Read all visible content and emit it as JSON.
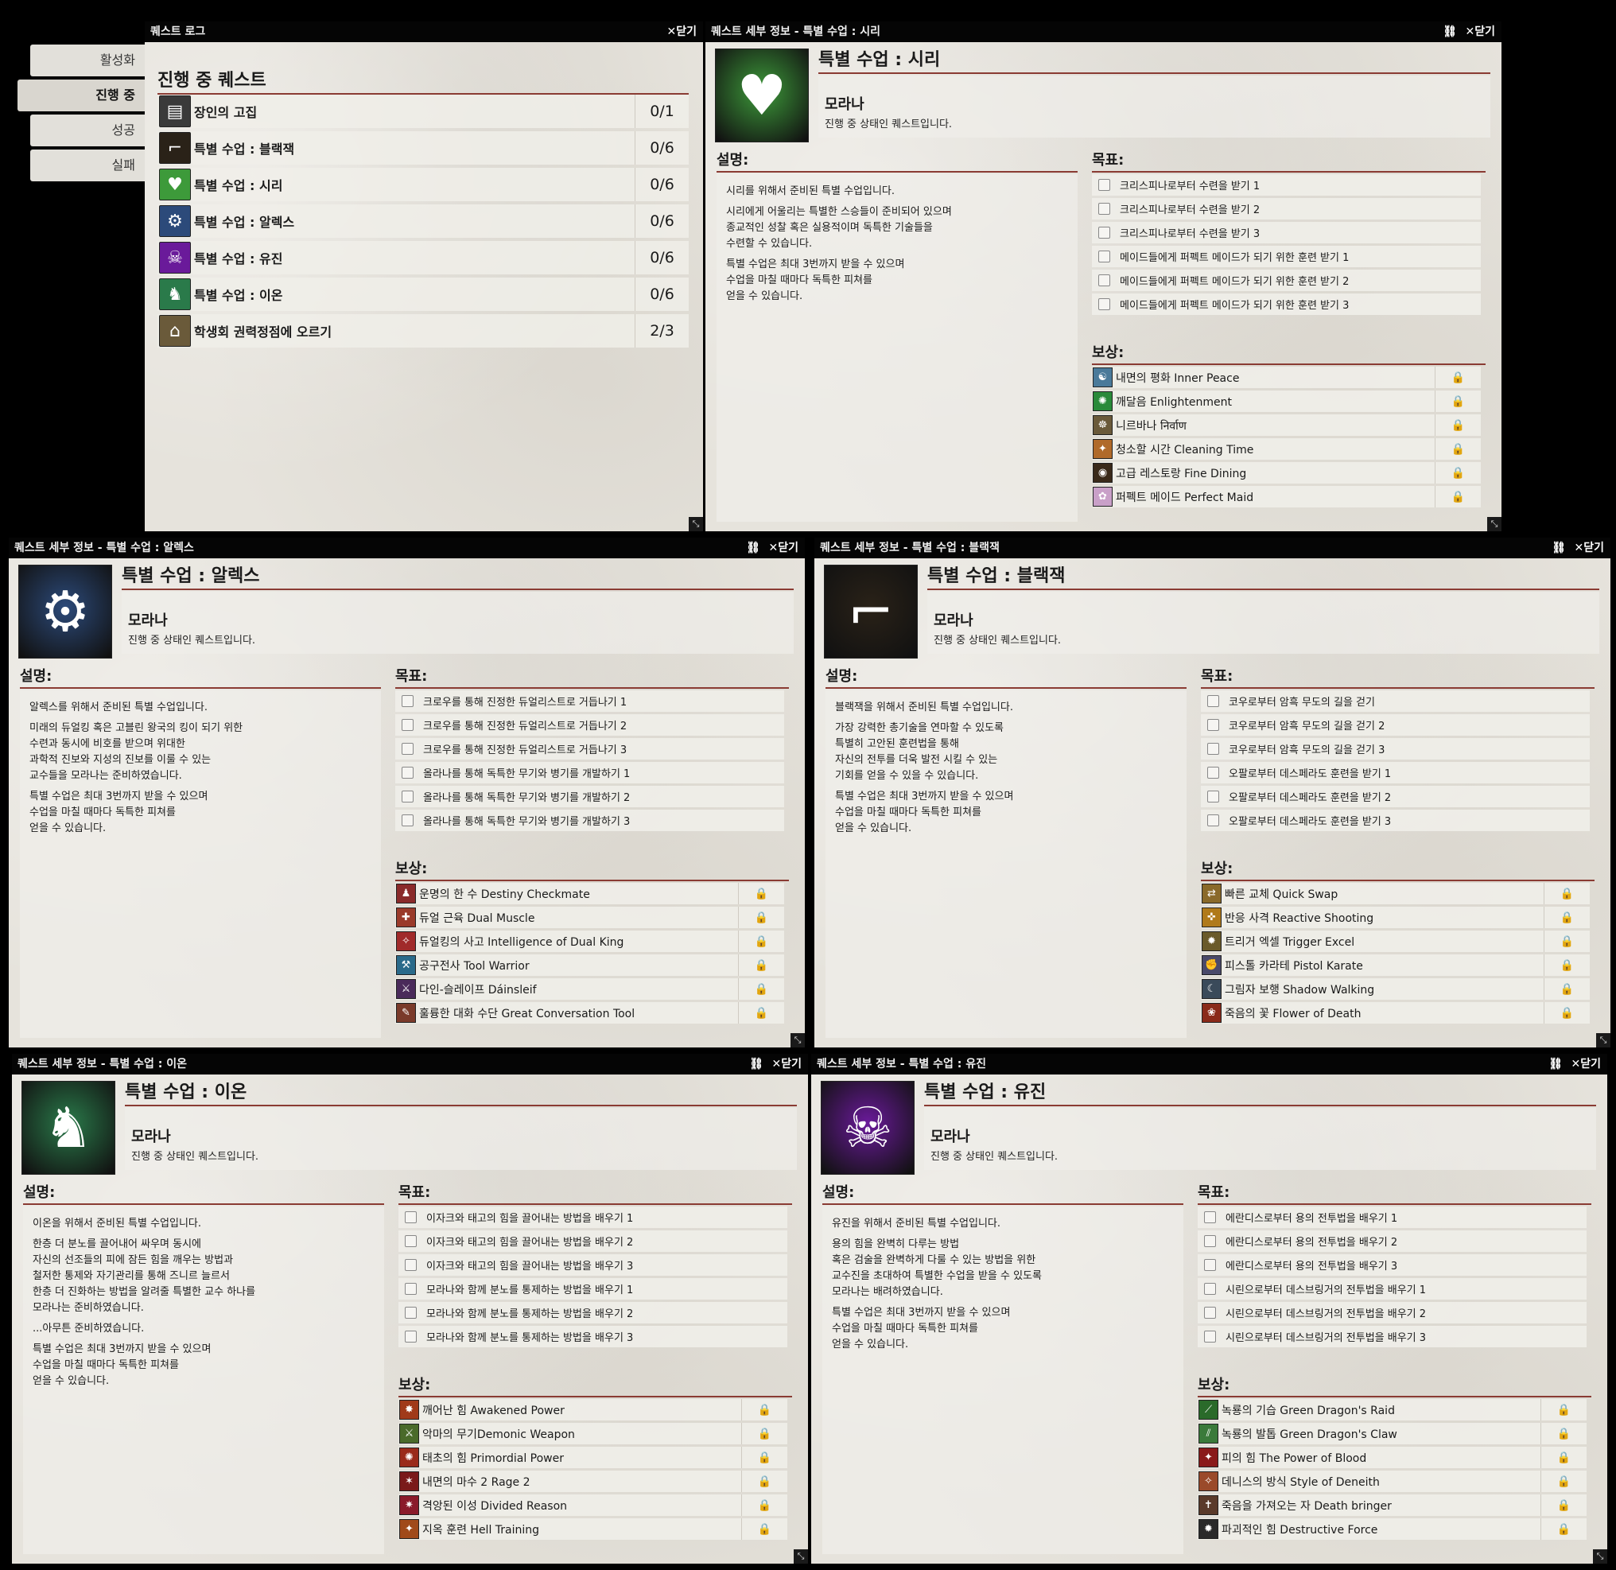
{
  "colors": {
    "accent": "#8a3b33",
    "titlebar": "#050505",
    "paper": "#e6e3dc"
  },
  "quest_log": {
    "window_title": "퀘스트 로그",
    "close_label": "✕닫기",
    "tabs": [
      "활성화",
      "진행 중",
      "성공",
      "실패"
    ],
    "active_tab": "진행 중",
    "heading": "진행 중 퀘스트",
    "quests": [
      {
        "name": "장인의 고집",
        "progress": "0/1",
        "icon": "book-icon",
        "glyph": "▤",
        "color": "#3a3a3a"
      },
      {
        "name": "특별 수업 : 블랙잭",
        "progress": "0/6",
        "icon": "rifle-icon",
        "glyph": "⌐",
        "color": "#2a2218"
      },
      {
        "name": "특별 수업 : 시리",
        "progress": "0/6",
        "icon": "heart-hand-icon",
        "glyph": "♥",
        "color": "#3d9a3a"
      },
      {
        "name": "특별 수업 : 알렉스",
        "progress": "0/6",
        "icon": "gear-icon",
        "glyph": "⚙",
        "color": "#2c4a7a"
      },
      {
        "name": "특별 수업 : 유진",
        "progress": "0/6",
        "icon": "dragon-icon",
        "glyph": "☠",
        "color": "#6a1a9a"
      },
      {
        "name": "특별 수업 : 이온",
        "progress": "0/6",
        "icon": "bear-icon",
        "glyph": "♞",
        "color": "#2a7a4a"
      },
      {
        "name": "학생회 권력정점에 오르기",
        "progress": "2/3",
        "icon": "building-icon",
        "glyph": "⌂",
        "color": "#6a5a3a"
      }
    ]
  },
  "detail_common": {
    "window_prefix": "퀘스트 세부 정보 - ",
    "close_label": "✕닫기",
    "link_icon": "link-icon",
    "giver": "모라나",
    "status": "진행 중 상태인 퀘스트입니다.",
    "desc_label": "설명:",
    "obj_label": "목표:",
    "reward_label": "보상:"
  },
  "details": [
    {
      "window_title": "퀘스트 세부 정보 - 특별 수업 : 시리",
      "title": "특별 수업 : 시리",
      "icon": "heart-hand-icon",
      "glyph": "♥",
      "color": "#3d9a3a",
      "desc": [
        "시리를 위해서 준비된 특별 수업입니다.",
        "시리에게 어울리는 특별한 스승들이 준비되어 있으며\n종교적인 성찰 혹은 실용적이며 독특한 기술들을\n수련할 수 있습니다.",
        "특별 수업은 최대 3번까지 받을 수 있으며\n수업을 마칠 때마다 독특한 피쳐를\n얻을 수 있습니다."
      ],
      "objectives": [
        "크리스피나로부터 수련을 받기 1",
        "크리스피나로부터 수련을 받기 2",
        "크리스피나로부터 수련을 받기 3",
        "메이드들에게 퍼펙트 메이드가 되기 위한 훈련 받기 1",
        "메이드들에게 퍼펙트 메이드가 되기 위한 훈련 받기 2",
        "메이드들에게 퍼펙트 메이드가 되기 위한 훈련 받기 3"
      ],
      "rewards": [
        {
          "name": "내면의 평화 Inner Peace",
          "color": "#4a7a9a",
          "glyph": "☯"
        },
        {
          "name": "깨달음 Enlightenment",
          "color": "#2a8a3a",
          "glyph": "✺"
        },
        {
          "name": "니르바나 निर्वाण",
          "color": "#6a5a3a",
          "glyph": "☸"
        },
        {
          "name": "청소할 시간 Cleaning Time",
          "color": "#b06a2a",
          "glyph": "✦"
        },
        {
          "name": "고급 레스토랑 Fine Dining",
          "color": "#3a2a1a",
          "glyph": "◉"
        },
        {
          "name": "퍼펙트 메이드 Perfect Maid",
          "color": "#c9a0c8",
          "glyph": "✿"
        }
      ]
    },
    {
      "window_title": "퀘스트 세부 정보 - 특별 수업 : 알렉스",
      "title": "특별 수업 : 알렉스",
      "icon": "gear-icon",
      "glyph": "⚙",
      "color": "#2c4a7a",
      "desc": [
        "알렉스를 위해서 준비된 특별 수업입니다.",
        "미래의 듀얼킹 혹은 고블린 왕국의 킹이 되기 위한\n수련과 동시에  비호를 받으며 위대한\n과학적 진보와 지성의 진보를 이룰 수 있는\n교수들을 모라나는 준비하였습니다.",
        "특별 수업은 최대 3번까지 받을 수 있으며\n수업을 마칠 때마다 독특한 피쳐를\n얻을 수 있습니다."
      ],
      "objectives": [
        "크로우를 통해 진정한 듀얼리스트로 거듭나기 1",
        "크로우를 통해 진정한 듀얼리스트로 거듭나기 2",
        "크로우를 통해 진정한 듀얼리스트로 거듭나기 3",
        "올라나를 통해 독특한 무기와 병기를 개발하기 1",
        "올라나를 통해 독특한 무기와 병기를 개발하기 2",
        "올라나를 통해 독특한 무기와 병기를 개발하기 3"
      ],
      "rewards": [
        {
          "name": "운명의 한 수 Destiny Checkmate",
          "color": "#8a2a2a",
          "glyph": "♟"
        },
        {
          "name": "듀얼 근육 Dual Muscle",
          "color": "#9a3a2a",
          "glyph": "✚"
        },
        {
          "name": "듀얼킹의 사고 Intelligence of Dual King",
          "color": "#a02a2a",
          "glyph": "✧"
        },
        {
          "name": "공구전사 Tool Warrior",
          "color": "#2a6a8a",
          "glyph": "⚒"
        },
        {
          "name": "다인-슬레이프 Dáinsleif",
          "color": "#4a2a5a",
          "glyph": "⚔"
        },
        {
          "name": "훌륭한 대화 수단 Great Conversation Tool",
          "color": "#7a3a2a",
          "glyph": "✎"
        }
      ]
    },
    {
      "window_title": "퀘스트 세부 정보 - 특별 수업 : 블랙잭",
      "title": "특별 수업 : 블랙잭",
      "icon": "rifle-icon",
      "glyph": "⌐",
      "color": "#2a2218",
      "desc": [
        "블랙잭을 위해서 준비된 특별 수업입니다.",
        "가장 강력한 총기술을 연마할 수 있도록\n특별히 고안된 훈련법을 통해\n자신의 전투를 더욱 발전 시킬 수 있는\n기회를 얻을 수 있을 수 있습니다.",
        "특별 수업은 최대 3번까지 받을 수 있으며\n수업을 마칠 때마다 독특한 피쳐를\n얻을 수 있습니다."
      ],
      "objectives": [
        "코우로부터 암흑 무도의 길을 걷기",
        "코우로부터 암흑 무도의 길을 걷기 2",
        "코우로부터 암흑 무도의 길을 걷기 3",
        "오팔로부터 데스페라도 훈련을 받기 1",
        "오팔로부터 데스페라도 훈련을 받기 2",
        "오팔로부터 데스페라도 훈련을 받기 3"
      ],
      "rewards": [
        {
          "name": "빠른 교체 Quick Swap",
          "color": "#8a6a2a",
          "glyph": "⇄"
        },
        {
          "name": "반응 사격 Reactive Shooting",
          "color": "#b07a1a",
          "glyph": "✜"
        },
        {
          "name": "트리거 엑셀 Trigger Excel",
          "color": "#6a5a2a",
          "glyph": "✹"
        },
        {
          "name": "피스톨 카라테 Pistol Karate",
          "color": "#4a4a6a",
          "glyph": "✊"
        },
        {
          "name": "그림자 보행 Shadow Walking",
          "color": "#3a4a5a",
          "glyph": "☾"
        },
        {
          "name": "죽음의 꽃 Flower of Death",
          "color": "#8a2a1a",
          "glyph": "❀"
        }
      ]
    },
    {
      "window_title": "퀘스트 세부 정보 - 특별 수업 : 이온",
      "title": "특별 수업 : 이온",
      "icon": "bear-icon",
      "glyph": "♞",
      "color": "#2a7a4a",
      "desc": [
        "이온을 위해서 준비된 특별 수업입니다.",
        "한층 더 분노를 끌어내어 싸우며 동시에\n자신의 선조들의 피에 잠든 힘을 깨우는 방법과\n철저한 통제와 자기관리를 통해 즈니르 늘르서\n한층 더 진화하는 방법을 알려줄 특별한 교수 하나를\n모라나는 준비하였습니다.",
        "...아무튼 준비하였습니다.",
        "특별 수업은 최대 3번까지 받을 수 있으며\n수업을 마칠 때마다 독특한 피쳐를\n얻을 수 있습니다."
      ],
      "objectives": [
        "이자크와 태고의 힘을 끌어내는 방법을 배우기 1",
        "이자크와 태고의 힘을 끌어내는 방법을 배우기 2",
        "이자크와 태고의 힘을 끌어내는 방법을 배우기 3",
        "모라나와 함께 분노를 통제하는 방법을 배우기 1",
        "모라나와 함께 분노를 통제하는 방법을 배우기 2",
        "모라나와 함께 분노를 통제하는 방법을 배우기 3"
      ],
      "rewards": [
        {
          "name": "깨어난 힘 Awakened Power",
          "color": "#a03a1a",
          "glyph": "✸"
        },
        {
          "name": "악마의 무기Demonic Weapon",
          "color": "#4a6a2a",
          "glyph": "⚔"
        },
        {
          "name": "태초의 힘 Primordial Power",
          "color": "#9a2a1a",
          "glyph": "✺"
        },
        {
          "name": "내면의 마수 2 Rage 2",
          "color": "#7a1a1a",
          "glyph": "✶"
        },
        {
          "name": "격앙된 이성 Divided Reason",
          "color": "#8a1a2a",
          "glyph": "✷"
        },
        {
          "name": "지옥 훈련 Hell Training",
          "color": "#a04a1a",
          "glyph": "✦"
        }
      ]
    },
    {
      "window_title": "퀘스트 세부 정보 - 특별 수업 : 유진",
      "title": "특별 수업 : 유진",
      "icon": "dragon-icon",
      "glyph": "☠",
      "color": "#6a1a9a",
      "desc": [
        "유진을 위해서 준비된 특별 수업입니다.",
        "용의 힘을 완벽히 다루는 방법\n혹은 검술을 완벽하게 다룰 수 있는 방법을 위한\n교수진을 초대하여 특별한 수업을 받을 수 있도록\n모라나는 배려하였습니다.",
        "특별 수업은 최대 3번까지 받을 수 있으며\n수업을 마칠 때마다 독특한 피쳐를\n얻을 수 있습니다."
      ],
      "objectives": [
        "에란디스로부터 용의 전투법을 배우기 1",
        "에란디스로부터 용의 전투법을 배우기 2",
        "에란디스로부터 용의 전투법을 배우기 3",
        "시린으로부터 데스브링거의 전투법을 배우기 1",
        "시린으로부터 데스브링거의 전투법을 배우기 2",
        "시린으로부터 데스브링거의 전투법을 배우기 3"
      ],
      "rewards": [
        {
          "name": "녹룡의 기습 Green Dragon's Raid",
          "color": "#2a6a2a",
          "glyph": "⟋"
        },
        {
          "name": "녹룡의 발톱 Green Dragon's Claw",
          "color": "#3a7a3a",
          "glyph": "⫽"
        },
        {
          "name": "피의 힘 The Power of Blood",
          "color": "#8a1a1a",
          "glyph": "✦"
        },
        {
          "name": "데니스의 방식 Style of Deneith",
          "color": "#9a4a2a",
          "glyph": "✧"
        },
        {
          "name": "죽음을 가져오는 자 Death bringer",
          "color": "#5a3a2a",
          "glyph": "✝"
        },
        {
          "name": "파괴적인 힘 Destructive Force",
          "color": "#2a2a2a",
          "glyph": "✹"
        }
      ]
    }
  ]
}
